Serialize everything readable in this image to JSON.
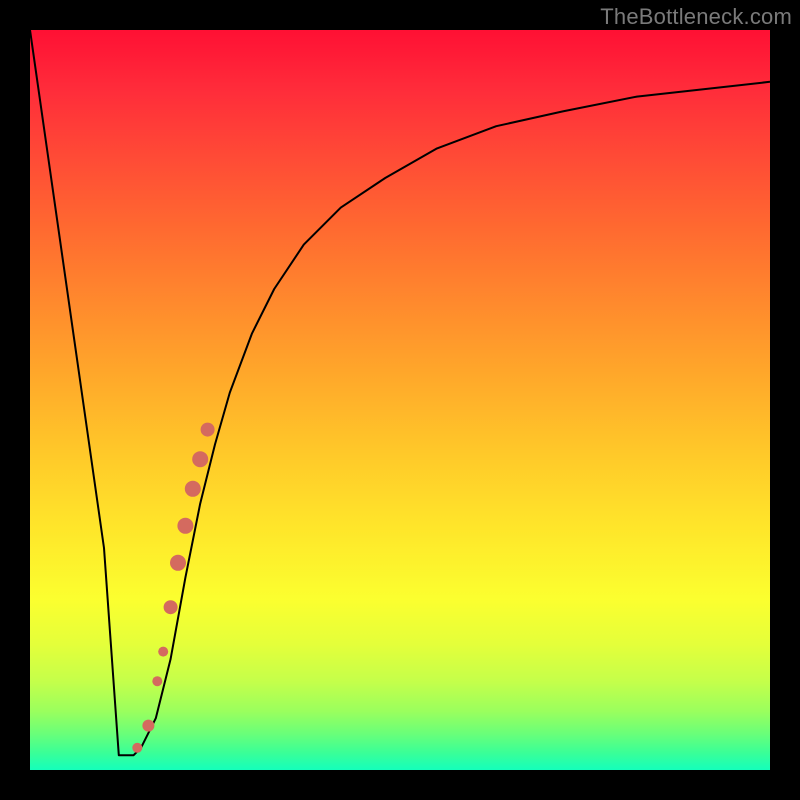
{
  "watermark": "TheBottleneck.com",
  "chart_data": {
    "type": "line",
    "title": "",
    "xlabel": "",
    "ylabel": "",
    "xlim": [
      0,
      100
    ],
    "ylim": [
      0,
      100
    ],
    "grid": false,
    "legend": false,
    "axes_visible": false,
    "background_gradient": {
      "direction": "vertical",
      "stops": [
        {
          "pos": 0.0,
          "color": "#ff1034"
        },
        {
          "pos": 0.08,
          "color": "#ff2c3a"
        },
        {
          "pos": 0.17,
          "color": "#ff4a36"
        },
        {
          "pos": 0.27,
          "color": "#ff6a30"
        },
        {
          "pos": 0.37,
          "color": "#ff8a2d"
        },
        {
          "pos": 0.47,
          "color": "#ffa92a"
        },
        {
          "pos": 0.57,
          "color": "#ffc829"
        },
        {
          "pos": 0.67,
          "color": "#ffe52a"
        },
        {
          "pos": 0.77,
          "color": "#fbff2f"
        },
        {
          "pos": 0.83,
          "color": "#e4ff3a"
        },
        {
          "pos": 0.88,
          "color": "#c5ff4a"
        },
        {
          "pos": 0.92,
          "color": "#9bff5d"
        },
        {
          "pos": 0.95,
          "color": "#6bff78"
        },
        {
          "pos": 0.975,
          "color": "#3dff95"
        },
        {
          "pos": 1.0,
          "color": "#14ffbb"
        }
      ]
    },
    "series": [
      {
        "name": "bottleneck-curve",
        "color": "#000000",
        "stroke_width": 2,
        "x": [
          0,
          2,
          4,
          6,
          8,
          10,
          11,
          12,
          13,
          14,
          15,
          17,
          19,
          21,
          23,
          25,
          27,
          30,
          33,
          37,
          42,
          48,
          55,
          63,
          72,
          82,
          91,
          100
        ],
        "y": [
          100,
          86,
          72,
          58,
          44,
          30,
          16,
          2,
          2,
          2,
          3,
          7,
          15,
          26,
          36,
          44,
          51,
          59,
          65,
          71,
          76,
          80,
          84,
          87,
          89,
          91,
          92,
          93
        ]
      }
    ],
    "markers": [
      {
        "name": "highlight-dots",
        "color": "#d46a5f",
        "points": [
          {
            "x": 14.5,
            "y": 3,
            "r": 5
          },
          {
            "x": 16.0,
            "y": 6,
            "r": 6
          },
          {
            "x": 17.2,
            "y": 12,
            "r": 5
          },
          {
            "x": 18.0,
            "y": 16,
            "r": 5
          },
          {
            "x": 19.0,
            "y": 22,
            "r": 7
          },
          {
            "x": 20.0,
            "y": 28,
            "r": 8
          },
          {
            "x": 21.0,
            "y": 33,
            "r": 8
          },
          {
            "x": 22.0,
            "y": 38,
            "r": 8
          },
          {
            "x": 23.0,
            "y": 42,
            "r": 8
          },
          {
            "x": 24.0,
            "y": 46,
            "r": 7
          }
        ]
      }
    ]
  }
}
